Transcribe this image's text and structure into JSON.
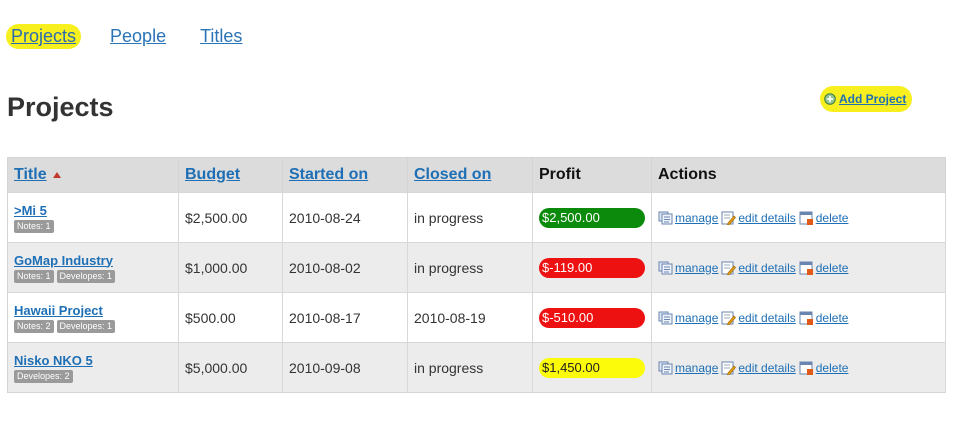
{
  "nav": {
    "items": [
      {
        "label": "Projects",
        "active": true
      },
      {
        "label": "People",
        "active": false
      },
      {
        "label": "Titles",
        "active": false
      }
    ]
  },
  "page": {
    "title": "Projects",
    "add_project_label": "Add Project"
  },
  "table": {
    "headers": {
      "title": "Title",
      "budget": "Budget",
      "started_on": "Started on",
      "closed_on": "Closed on",
      "profit": "Profit",
      "actions": "Actions"
    },
    "action_labels": {
      "manage": "manage",
      "edit": "edit details",
      "delete": "delete"
    },
    "rows": [
      {
        "title": ">Mi 5",
        "badges": [
          "Notes: 1"
        ],
        "budget": "$2,500.00",
        "started_on": "2010-08-24",
        "closed_on": "in progress",
        "profit": "$2,500.00",
        "profit_status": "green"
      },
      {
        "title": "GoMap Industry",
        "badges": [
          "Notes: 1",
          "Developes: 1"
        ],
        "budget": "$1,000.00",
        "started_on": "2010-08-02",
        "closed_on": "in progress",
        "profit": "$-119.00",
        "profit_status": "red"
      },
      {
        "title": "Hawaii Project",
        "badges": [
          "Notes: 2",
          "Developes: 1"
        ],
        "budget": "$500.00",
        "started_on": "2010-08-17",
        "closed_on": "2010-08-19",
        "profit": "$-510.00",
        "profit_status": "red"
      },
      {
        "title": "Nisko NKO 5",
        "badges": [
          "Developes: 2"
        ],
        "budget": "$5,000.00",
        "started_on": "2010-09-08",
        "closed_on": "in progress",
        "profit": "$1,450.00",
        "profit_status": "yellow"
      }
    ]
  },
  "colors": {
    "highlight": "#f7ef1e",
    "profit_green": "#0b8a0b",
    "profit_red": "#ee1111",
    "profit_yellow": "#fbfb0a",
    "link": "#1e6fb5"
  }
}
